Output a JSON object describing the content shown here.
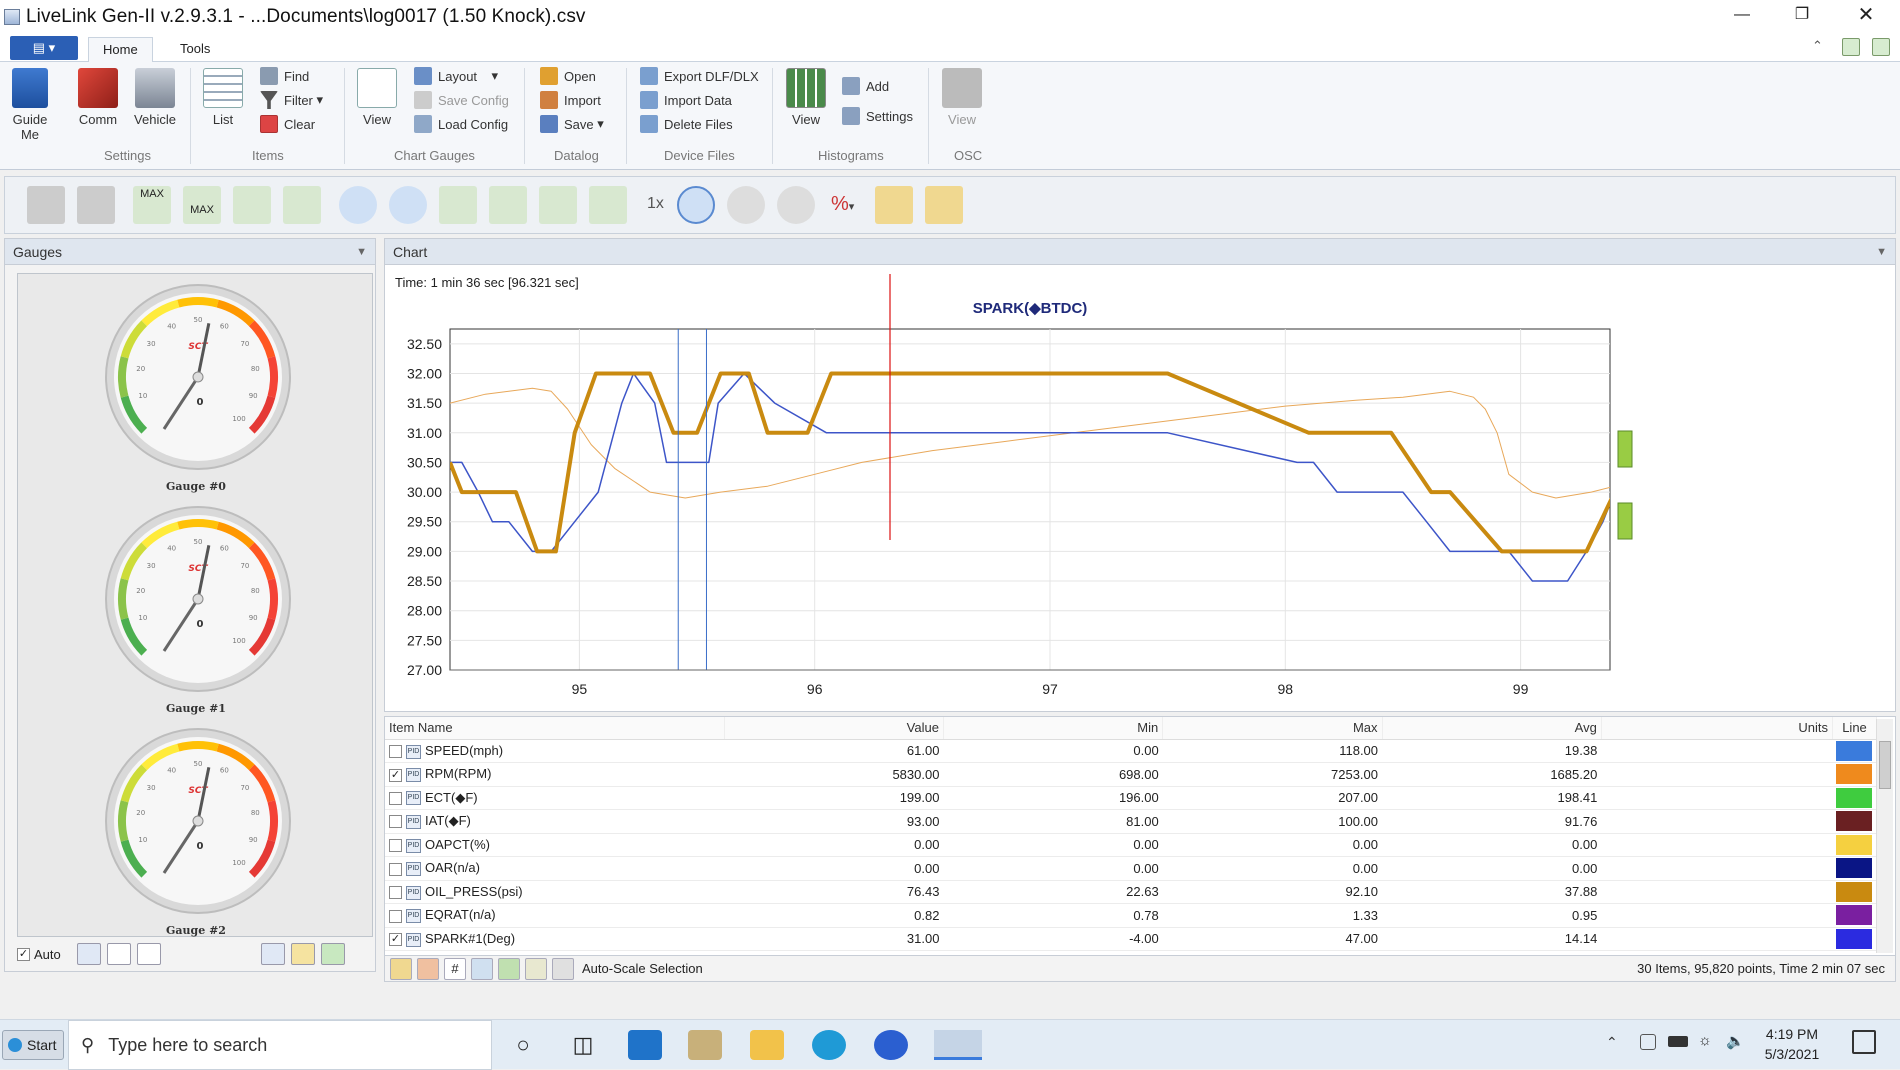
{
  "window": {
    "title": "LiveLink Gen-II  v.2.9.3.1 - ...Documents\\log0017 (1.50 Knock).csv"
  },
  "ribbon": {
    "tabs": [
      "Home",
      "Tools"
    ],
    "settings": {
      "guide": "Guide Me",
      "comm": "Comm",
      "vehicle": "Vehicle",
      "label": "Settings"
    },
    "items": {
      "list": "List",
      "find": "Find",
      "filter": "Filter",
      "clear": "Clear",
      "label": "Items"
    },
    "chart": {
      "view": "View",
      "layout": "Layout",
      "save_config": "Save Config",
      "load_config": "Load Config",
      "label": "Chart  Gauges"
    },
    "datalog": {
      "open": "Open",
      "import": "Import",
      "save": "Save",
      "label": "Datalog"
    },
    "device_files": {
      "export": "Export DLF/DLX",
      "import_data": "Import Data",
      "delete": "Delete Files",
      "label": "Device Files"
    },
    "histograms": {
      "view": "View",
      "add": "Add",
      "settings": "Settings",
      "label": "Histograms"
    },
    "osc": {
      "view": "View",
      "label": "OSC"
    }
  },
  "toolbar": {
    "speed": "1x",
    "max1": "MAX",
    "max2": "MAX",
    "percent": "%"
  },
  "gauges": {
    "title": "Gauges",
    "items": [
      {
        "label": "Gauge #0"
      },
      {
        "label": "Gauge #1"
      },
      {
        "label": "Gauge #2"
      }
    ],
    "ticks": [
      "10",
      "20",
      "30",
      "40",
      "50",
      "60",
      "70",
      "80",
      "90",
      "100"
    ],
    "brand": "SCT",
    "value": "0",
    "auto_label": "Auto"
  },
  "chart": {
    "panel_title": "Chart",
    "time_label": "Time: 1 min 36 sec [96.321 sec]"
  },
  "chart_data": {
    "type": "line",
    "title": "SPARK(\u0000BTDC)",
    "xlim": [
      94.45,
      99.38
    ],
    "ylim": [
      27.0,
      32.75
    ],
    "x_ticks": [
      95,
      96,
      97,
      98,
      99
    ],
    "y_ticks": [
      27.0,
      27.5,
      28.0,
      28.5,
      29.0,
      29.5,
      30.0,
      30.5,
      31.0,
      31.5,
      32.0,
      32.5
    ],
    "cursors": {
      "red": 96.32,
      "blue1": 95.42,
      "blue2": 95.54
    },
    "series": [
      {
        "color": "#c98a10",
        "width": 4,
        "x": [
          94.45,
          94.5,
          94.55,
          94.65,
          94.73,
          94.82,
          94.9,
          94.98,
          95.07,
          95.1,
          95.3,
          95.4,
          95.5,
          95.6,
          95.72,
          95.8,
          95.97,
          96.07,
          96.2,
          96.55,
          97.5,
          98.1,
          98.16,
          98.22,
          98.45,
          98.62,
          98.7,
          98.92,
          99.02,
          99.2,
          99.28,
          99.4,
          99.45,
          99.5,
          99.65,
          99.7,
          99.8,
          99.83,
          99.9,
          99.95,
          100.0
        ],
        "y": [
          30.5,
          30.0,
          30.0,
          30.0,
          30.0,
          29.0,
          29.0,
          31.0,
          32.0,
          32.0,
          32.0,
          31.0,
          31.0,
          32.0,
          32.0,
          31.0,
          31.0,
          32.0,
          32.0,
          32.0,
          32.0,
          31.0,
          31.0,
          31.0,
          31.0,
          30.0,
          30.0,
          29.0,
          29.0,
          29.0,
          29.0,
          30.0,
          31.0,
          30.0,
          30.0,
          32.0,
          32.0,
          31.0,
          31.0,
          32.0,
          32.0
        ]
      },
      {
        "color": "#3d55c8",
        "width": 1.5,
        "x": [
          94.45,
          94.5,
          94.57,
          94.63,
          94.7,
          94.8,
          94.88,
          94.98,
          95.08,
          95.18,
          95.23,
          95.32,
          95.37,
          95.45,
          95.55,
          95.59,
          95.7,
          95.83,
          96.05,
          96.22,
          96.28,
          96.5,
          97.5,
          98.05,
          98.12,
          98.22,
          98.3,
          98.5,
          98.6,
          98.7,
          98.82,
          98.95,
          99.05,
          99.1,
          99.2,
          99.28,
          99.35,
          99.4,
          99.45,
          99.5,
          99.6,
          99.7
        ],
        "y": [
          30.5,
          30.5,
          30.0,
          29.5,
          29.5,
          29.0,
          29.0,
          29.5,
          30.0,
          31.5,
          32.0,
          31.5,
          30.5,
          30.5,
          30.5,
          31.5,
          32.0,
          31.5,
          31.0,
          31.0,
          31.0,
          31.0,
          31.0,
          30.5,
          30.5,
          30.0,
          30.0,
          30.0,
          29.5,
          29.0,
          29.0,
          29.0,
          28.5,
          28.5,
          28.5,
          29.0,
          29.5,
          30.0,
          31.0,
          31.0,
          31.0,
          30.0
        ]
      },
      {
        "color": "#e8a85a",
        "width": 1,
        "x": [
          94.45,
          94.6,
          94.7,
          94.8,
          94.88,
          94.95,
          95.05,
          95.15,
          95.3,
          95.45,
          95.6,
          95.8,
          96.0,
          96.2,
          96.5,
          96.8,
          97.1,
          97.4,
          97.7,
          98.0,
          98.3,
          98.5,
          98.7,
          98.8,
          98.85,
          98.9,
          98.95,
          99.05,
          99.15,
          99.3,
          99.4,
          99.45,
          99.5,
          99.7,
          99.9,
          100.0
        ],
        "y": [
          31.5,
          31.65,
          31.7,
          31.75,
          31.7,
          31.4,
          30.8,
          30.4,
          30.0,
          29.9,
          30.0,
          30.1,
          30.3,
          30.5,
          30.7,
          30.85,
          31.0,
          31.15,
          31.3,
          31.45,
          31.55,
          31.6,
          31.7,
          31.6,
          31.4,
          31.0,
          30.3,
          30.0,
          29.9,
          30.0,
          30.1,
          30.05,
          30.0,
          30.0,
          30.05,
          30.1
        ]
      }
    ]
  },
  "grid": {
    "headers": {
      "name": "Item Name",
      "value": "Value",
      "min": "Min",
      "max": "Max",
      "avg": "Avg",
      "units": "Units",
      "line": "Line"
    },
    "rows": [
      {
        "checked": false,
        "name": "SPEED(mph)",
        "value": "61.00",
        "min": "0.00",
        "max": "118.00",
        "avg": "19.38",
        "color": "#3a7bdc"
      },
      {
        "checked": true,
        "name": "RPM(RPM)",
        "value": "5830.00",
        "min": "698.00",
        "max": "7253.00",
        "avg": "1685.20",
        "color": "#ef8a1d"
      },
      {
        "checked": false,
        "name": "ECT(\u0000F)",
        "value": "199.00",
        "min": "196.00",
        "max": "207.00",
        "avg": "198.41",
        "color": "#3fcc3f"
      },
      {
        "checked": false,
        "name": "IAT(\u0000F)",
        "value": "93.00",
        "min": "81.00",
        "max": "100.00",
        "avg": "91.76",
        "color": "#6a2022"
      },
      {
        "checked": false,
        "name": "OAPCT(%)",
        "value": "0.00",
        "min": "0.00",
        "max": "0.00",
        "avg": "0.00",
        "color": "#f5d040"
      },
      {
        "checked": false,
        "name": "OAR(n/a)",
        "value": "0.00",
        "min": "0.00",
        "max": "0.00",
        "avg": "0.00",
        "color": "#0a1585"
      },
      {
        "checked": false,
        "name": "OIL_PRESS(psi)",
        "value": "76.43",
        "min": "22.63",
        "max": "92.10",
        "avg": "37.88",
        "color": "#c98a10"
      },
      {
        "checked": false,
        "name": "EQRAT(n/a)",
        "value": "0.82",
        "min": "0.78",
        "max": "1.33",
        "avg": "0.95",
        "color": "#7a1fa0"
      },
      {
        "checked": true,
        "name": "SPARK#1(Deg)",
        "value": "31.00",
        "min": "-4.00",
        "max": "47.00",
        "avg": "14.14",
        "color": "#2b2be0"
      }
    ],
    "footer": {
      "autoscale": "Auto-Scale Selection",
      "status": "30 Items, 95,820 points, Time 2 min 07 sec"
    }
  },
  "taskbar": {
    "start": "Start",
    "search_placeholder": "Type here to search",
    "time": "4:19 PM",
    "date": "5/3/2021"
  }
}
